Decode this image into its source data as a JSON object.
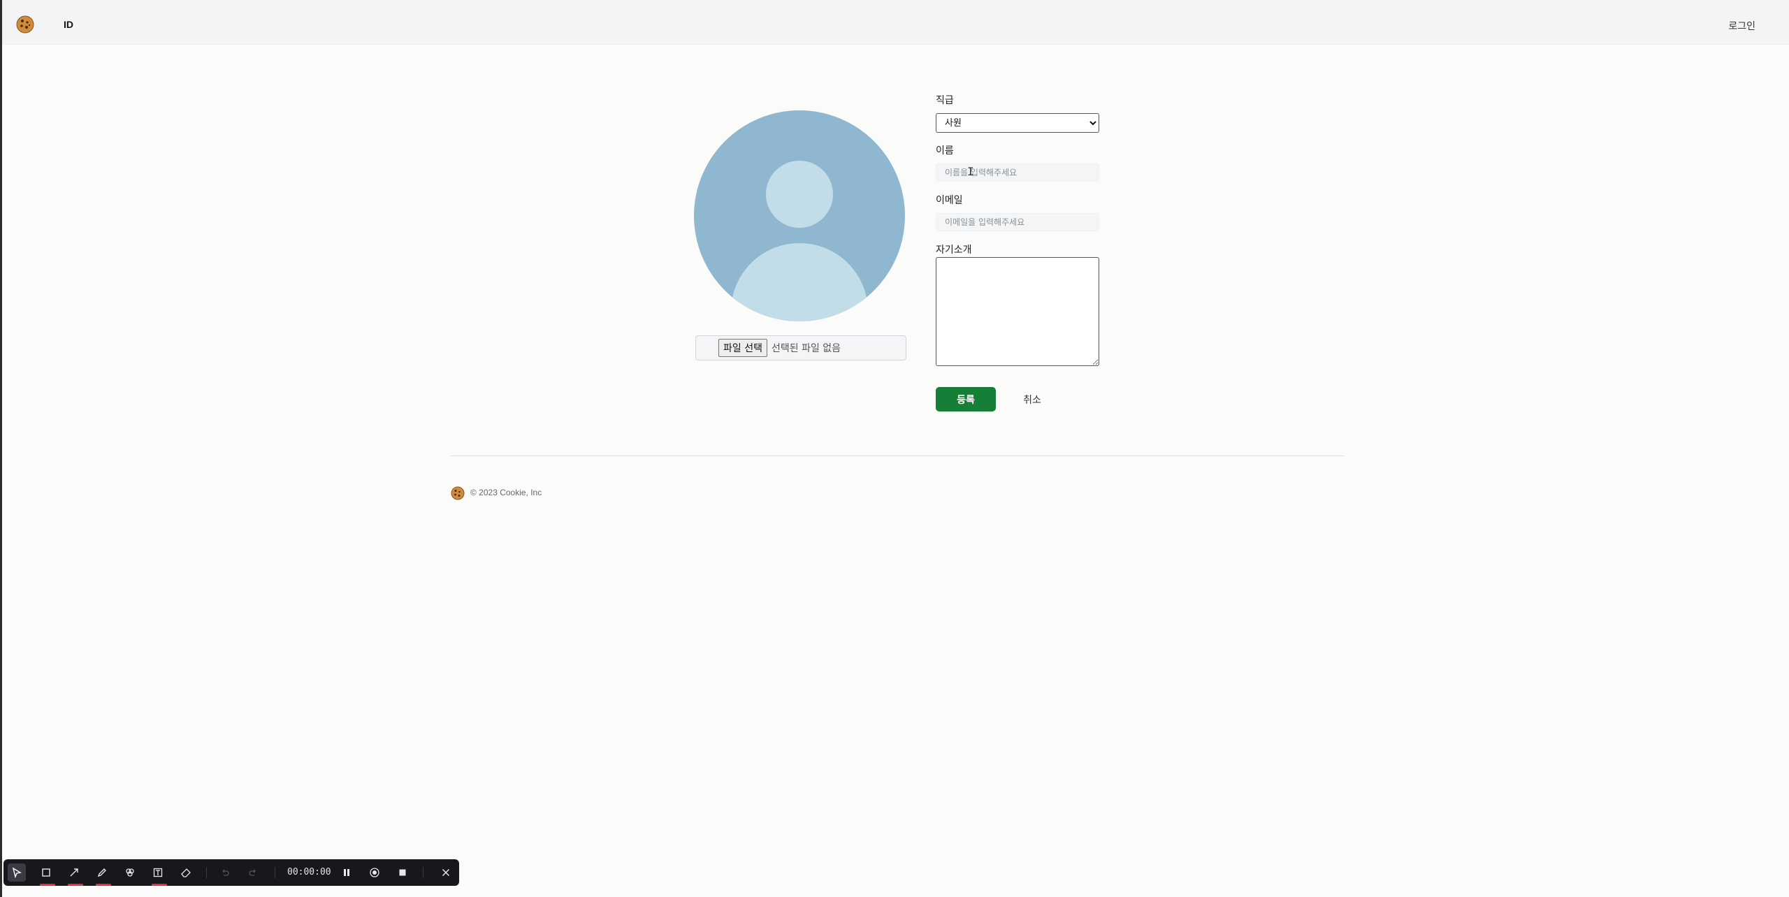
{
  "header": {
    "site_id": "ID",
    "login_label": "로그인"
  },
  "profile": {
    "file_button_label": "파일 선택",
    "file_status": "선택된 파일 없음"
  },
  "form": {
    "position_label": "직급",
    "position_value": "사원",
    "position_options": [
      "사원"
    ],
    "name_label": "이름",
    "name_placeholder": "이름을 입력해주세요",
    "name_value": "",
    "email_label": "이메일",
    "email_placeholder": "이메일을 입력해주세요",
    "email_value": "",
    "bio_label": "자기소개",
    "bio_value": "",
    "submit_label": "등록",
    "cancel_label": "취소"
  },
  "footer": {
    "copyright": "© 2023 Cookie, Inc"
  },
  "recorder_toolbar": {
    "timer": "00:00:00",
    "tools": [
      "select-icon",
      "rectangle-icon",
      "arrow-icon",
      "pen-icon",
      "highlighter-icon",
      "text-icon",
      "eraser-icon",
      "undo-icon",
      "redo-icon",
      "pause-icon",
      "record-icon",
      "stop-icon",
      "close-icon"
    ],
    "accent_color": "#e2313f"
  },
  "colors": {
    "primary_button": "#177e37",
    "avatar_bg": "#8fb8d0",
    "avatar_figure": "#c3dde8"
  }
}
